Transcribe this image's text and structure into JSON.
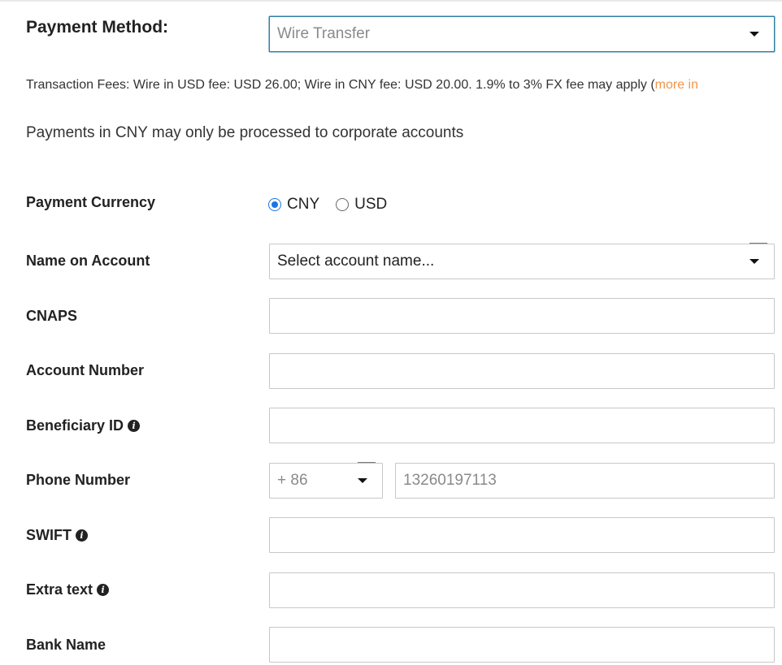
{
  "payment_method": {
    "label": "Payment Method:",
    "selected": "Wire Transfer"
  },
  "fees": {
    "text": "Transaction Fees: Wire in USD fee: USD 26.00; Wire in CNY fee: USD 20.00. 1.9% to 3% FX fee may apply (",
    "link": "more in"
  },
  "note": "Payments in CNY may only be processed to corporate accounts",
  "currency": {
    "label": "Payment Currency",
    "options": [
      "CNY",
      "USD"
    ],
    "selected": "CNY"
  },
  "name_on_account": {
    "label": "Name on Account",
    "placeholder": "Select account name..."
  },
  "cnaps": {
    "label": "CNAPS",
    "value": ""
  },
  "account_number": {
    "label": "Account Number",
    "value": ""
  },
  "beneficiary_id": {
    "label": "Beneficiary ID",
    "value": ""
  },
  "phone": {
    "label": "Phone Number",
    "country_code": "+ 86",
    "placeholder": "13260197113"
  },
  "swift": {
    "label": "SWIFT",
    "value": ""
  },
  "extra_text": {
    "label": "Extra text",
    "value": ""
  },
  "bank_name": {
    "label": "Bank Name",
    "value": ""
  },
  "icons": {
    "info": "info-icon",
    "dropdown": "caret-down-icon"
  },
  "colors": {
    "link": "#f0954b",
    "radio_checked": "#1a73e8",
    "focus_border": "#2f7fa8"
  }
}
